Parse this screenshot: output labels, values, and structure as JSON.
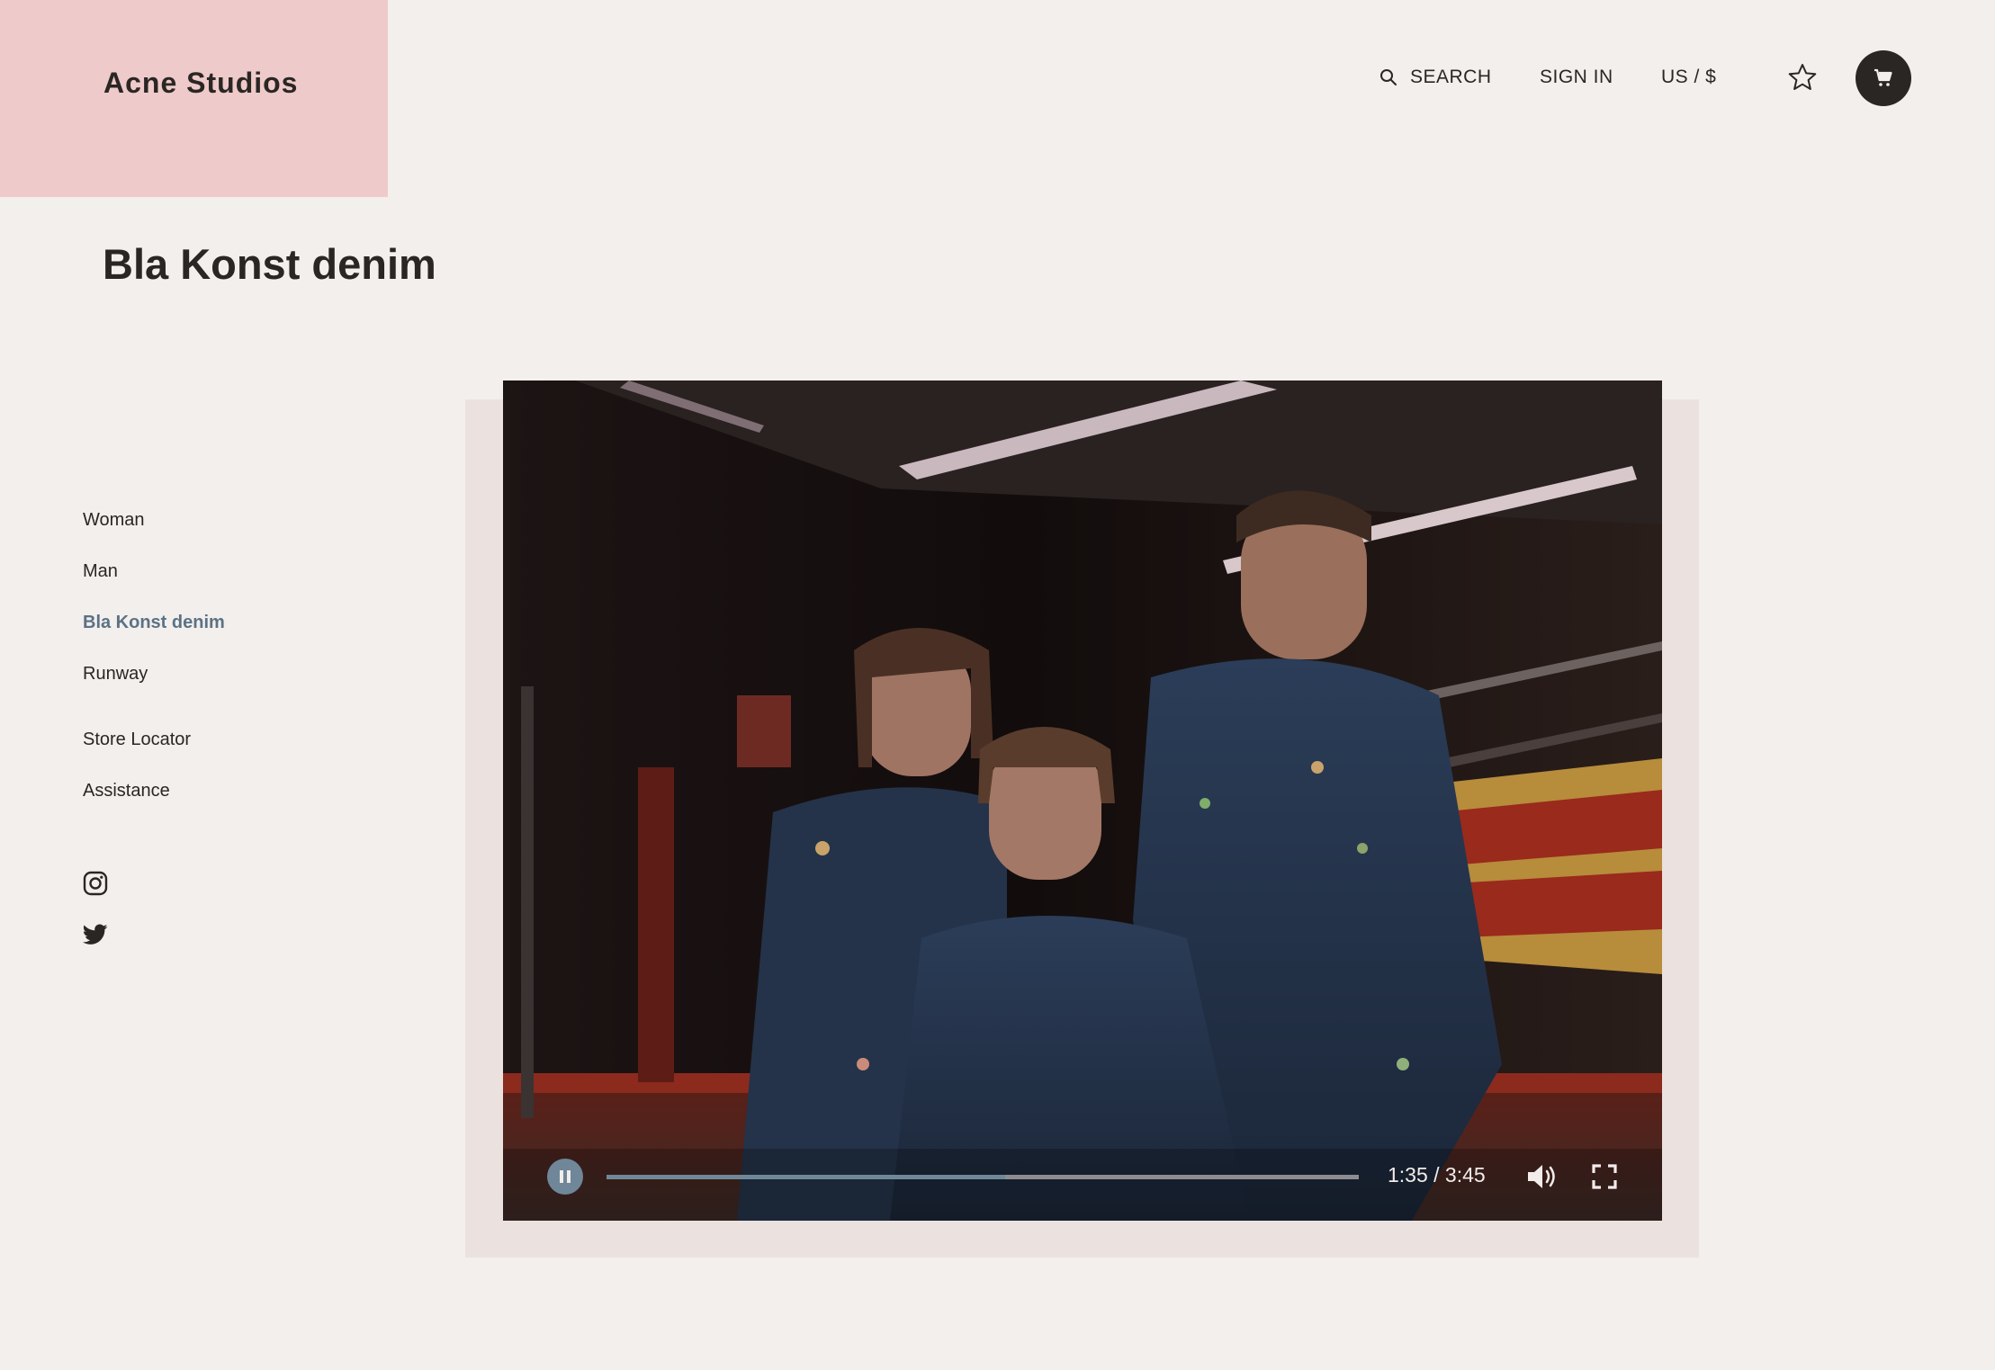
{
  "brand": {
    "name": "Acne Studios"
  },
  "header": {
    "search_label": "SEARCH",
    "signin_label": "SIGN IN",
    "currency_label": "US / $"
  },
  "page": {
    "title": "Bla Konst denim"
  },
  "sidebar": {
    "items": [
      {
        "label": "Woman"
      },
      {
        "label": "Man"
      },
      {
        "label": "Bla Konst denim",
        "active": true
      },
      {
        "label": "Runway"
      },
      {
        "label": "Store Locator"
      },
      {
        "label": "Assistance"
      }
    ],
    "social": [
      "instagram-icon",
      "twitter-icon"
    ]
  },
  "video": {
    "time": "1:35 / 3:45",
    "state": "playing",
    "progress": 0.53
  },
  "colors": {
    "accent": "#6f8799",
    "logo_bg": "#efcaca",
    "page_bg": "#f3efec",
    "active_link": "#5b7285"
  }
}
